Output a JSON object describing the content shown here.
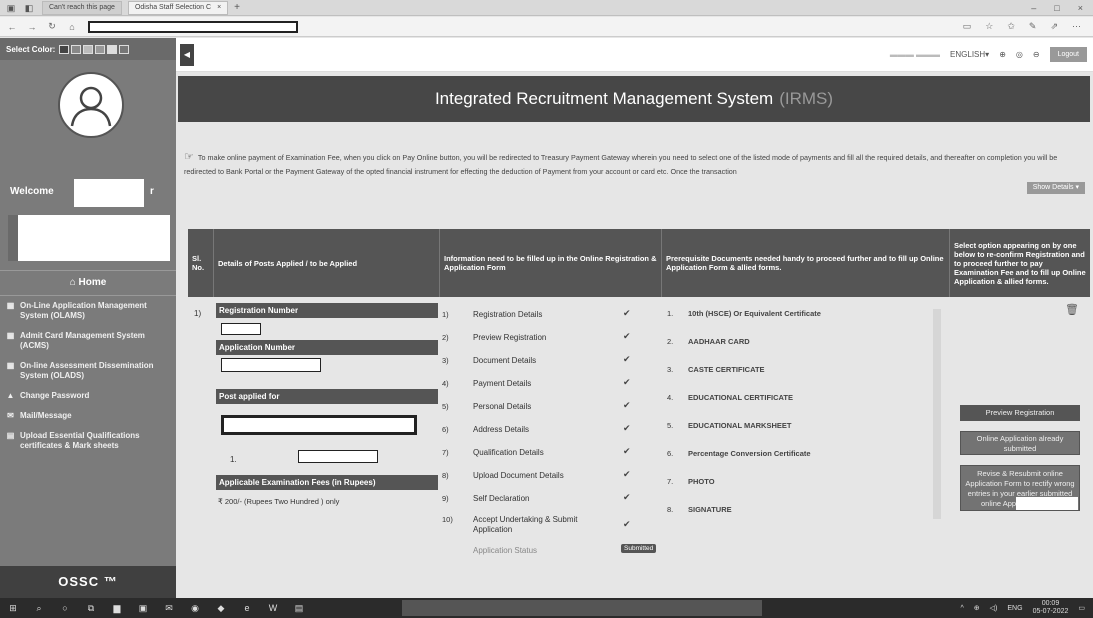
{
  "browser": {
    "tabs": [
      {
        "label": "Can't reach this page",
        "active": false
      },
      {
        "label": "Odisha Staff Selection C",
        "active": true
      }
    ]
  },
  "sidebar": {
    "select_color_label": "Select Color:",
    "swatches": [
      "#444444",
      "#888888",
      "#bbbbbb",
      "#999999",
      "#dddddd",
      "#777777"
    ],
    "welcome_prefix": "Welcome",
    "welcome_suffix": "r",
    "home_label": "Home",
    "menu": [
      {
        "icon": "grid-icon",
        "label": "On-Line Application Management System (OLAMS)"
      },
      {
        "icon": "grid-icon",
        "label": "Admit Card Management System (ACMS)"
      },
      {
        "icon": "grid-icon",
        "label": "On-line Assessment Dissemination System (OLADS)"
      },
      {
        "icon": "lock-icon",
        "label": "Change Password"
      },
      {
        "icon": "mail-icon",
        "label": "Mail/Message"
      },
      {
        "icon": "upload-icon",
        "label": "Upload Essential Qualifications certificates & Mark sheets"
      }
    ],
    "footer": "OSSC ™"
  },
  "topbar": {
    "language": "ENGLISH▾",
    "logout": "Logout"
  },
  "banner": {
    "title": "Integrated Recruitment Management System",
    "abbr": "(IRMS)"
  },
  "notice": {
    "text": "To make online payment of Examination Fee, when you click on Pay Online button, you will be redirected to Treasury Payment Gateway wherein you need to select one of the listed mode of payments and fill all the required details, and thereafter on completion you will be redirected to Bank Portal or the Payment Gateway of the opted financial instrument for effecting the deduction of Payment from your account or card etc. Once the transaction",
    "show_details": "Show Details ▾"
  },
  "table": {
    "headers": {
      "sl": "Sl. No.",
      "details": "Details of Posts Applied / to be Applied",
      "info": "Information need to be filled up in the Online Registration & Application Form",
      "prereq": "Prerequisite Documents needed handy to proceed further and to fill up Online Application Form & allied forms.",
      "select": "Select option appearing on by one below to re-confirm Registration and to proceed further to pay Examination Fee and to fill up Online Application & allied forms."
    },
    "row": {
      "sl": "1)",
      "registration_number_label": "Registration Number",
      "application_number_label": "Application Number",
      "post_applied_label": "Post applied for",
      "post_index": "1.",
      "fee_label": "Applicable Examination Fees (in Rupees)",
      "fee_value": "₹ 200/- (Rupees Two Hundred ) only"
    },
    "steps": [
      {
        "n": "1)",
        "label": "Registration Details",
        "check": "✔"
      },
      {
        "n": "2)",
        "label": "Preview Registration",
        "check": "✔"
      },
      {
        "n": "3)",
        "label": "Document Details",
        "check": "✔"
      },
      {
        "n": "4)",
        "label": "Payment Details",
        "check": "✔"
      },
      {
        "n": "5)",
        "label": "Personal Details",
        "check": "✔"
      },
      {
        "n": "6)",
        "label": "Address Details",
        "check": "✔"
      },
      {
        "n": "7)",
        "label": "Qualification Details",
        "check": "✔"
      },
      {
        "n": "8)",
        "label": "Upload Document Details",
        "check": "✔"
      },
      {
        "n": "9)",
        "label": "Self Declaration",
        "check": "✔"
      },
      {
        "n": "10)",
        "label": "Accept Undertaking & Submit Application",
        "check": "✔"
      }
    ],
    "status_label": "Application Status",
    "status_badge": "Submitted",
    "documents": [
      {
        "n": "1.",
        "label": "10th (HSCE) Or Equivalent Certificate"
      },
      {
        "n": "2.",
        "label": "AADHAAR CARD"
      },
      {
        "n": "3.",
        "label": "CASTE CERTIFICATE"
      },
      {
        "n": "4.",
        "label": "EDUCATIONAL CERTIFICATE"
      },
      {
        "n": "5.",
        "label": "EDUCATIONAL MARKSHEET"
      },
      {
        "n": "6.",
        "label": "Percentage Conversion Certificate"
      },
      {
        "n": "7.",
        "label": "PHOTO"
      },
      {
        "n": "8.",
        "label": "SIGNATURE"
      }
    ],
    "actions": {
      "preview": "Preview Registration",
      "submitted": "Online Application already submitted",
      "revise": "Revise & Resubmit online Application Form to rectify wrong entries in your earlier submitted online Application Form"
    }
  },
  "taskbar": {
    "lang": "ENG",
    "time": "00:09",
    "date": "05-07-2022"
  }
}
